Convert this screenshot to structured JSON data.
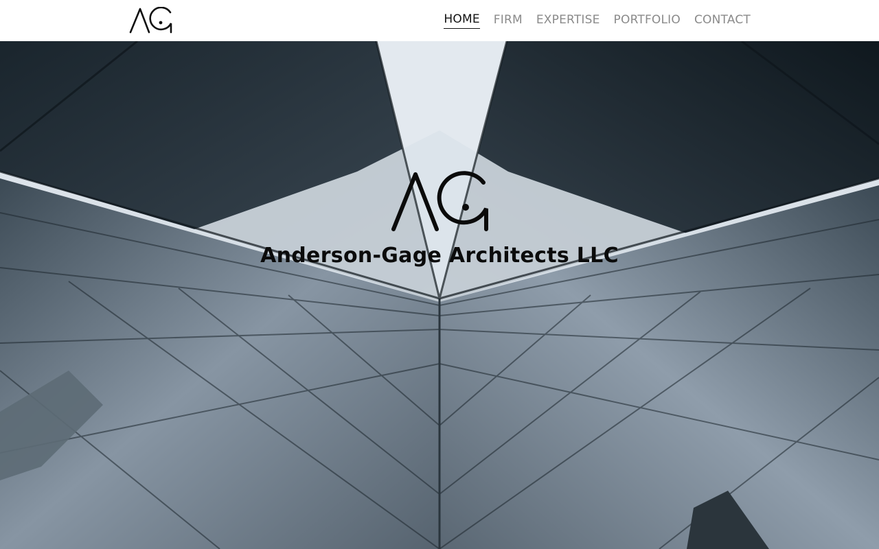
{
  "brand": {
    "logo_text": "AG",
    "company_name": "Anderson-Gage Architects LLC"
  },
  "nav": {
    "items": [
      {
        "label": "HOME",
        "active": true
      },
      {
        "label": "FIRM",
        "active": false
      },
      {
        "label": "EXPERTISE",
        "active": false
      },
      {
        "label": "PORTFOLIO",
        "active": false
      },
      {
        "label": "CONTACT",
        "active": false
      }
    ]
  },
  "colors": {
    "nav_active": "#111111",
    "nav_inactive": "#8a8a8a",
    "sky": "#dfe6ee",
    "building_dark": "#1e2b33",
    "glass": "#7c8c9a"
  },
  "hero": {
    "image": "low-angle-glass-skyscrapers-photo"
  }
}
